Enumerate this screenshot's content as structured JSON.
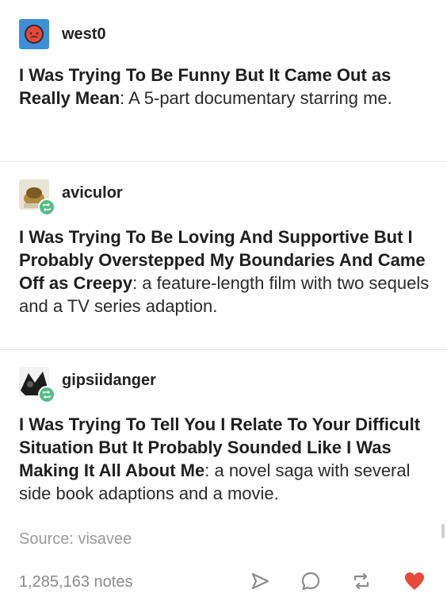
{
  "posts": [
    {
      "username": "west0",
      "title_bold": "I Was Trying To Be Funny But It Came Out as Really Mean",
      "body": ": A 5-part documentary starring me."
    },
    {
      "username": "aviculor",
      "title_bold": "I Was Trying To Be Loving And Supportive But I Probably Overstepped My Boundaries And Came Off as Creepy",
      "body": ": a feature-length film with two sequels and a TV series adaption."
    },
    {
      "username": "gipsiidanger",
      "title_bold": "I Was Trying To Tell You I Relate To Your Difficult Situation But It Probably Sounded Like I Was Making It All About Me",
      "body": ": a novel saga with several side book adaptions and a movie."
    }
  ],
  "footer": {
    "source": "Source: visavee",
    "notes": "1,285,163 notes",
    "actions": [
      "send-icon",
      "reply-icon",
      "reblog-icon",
      "heart-icon"
    ],
    "heart_color": "#e84a3a"
  },
  "colors": {
    "reblog_badge": "#56bc8a"
  }
}
